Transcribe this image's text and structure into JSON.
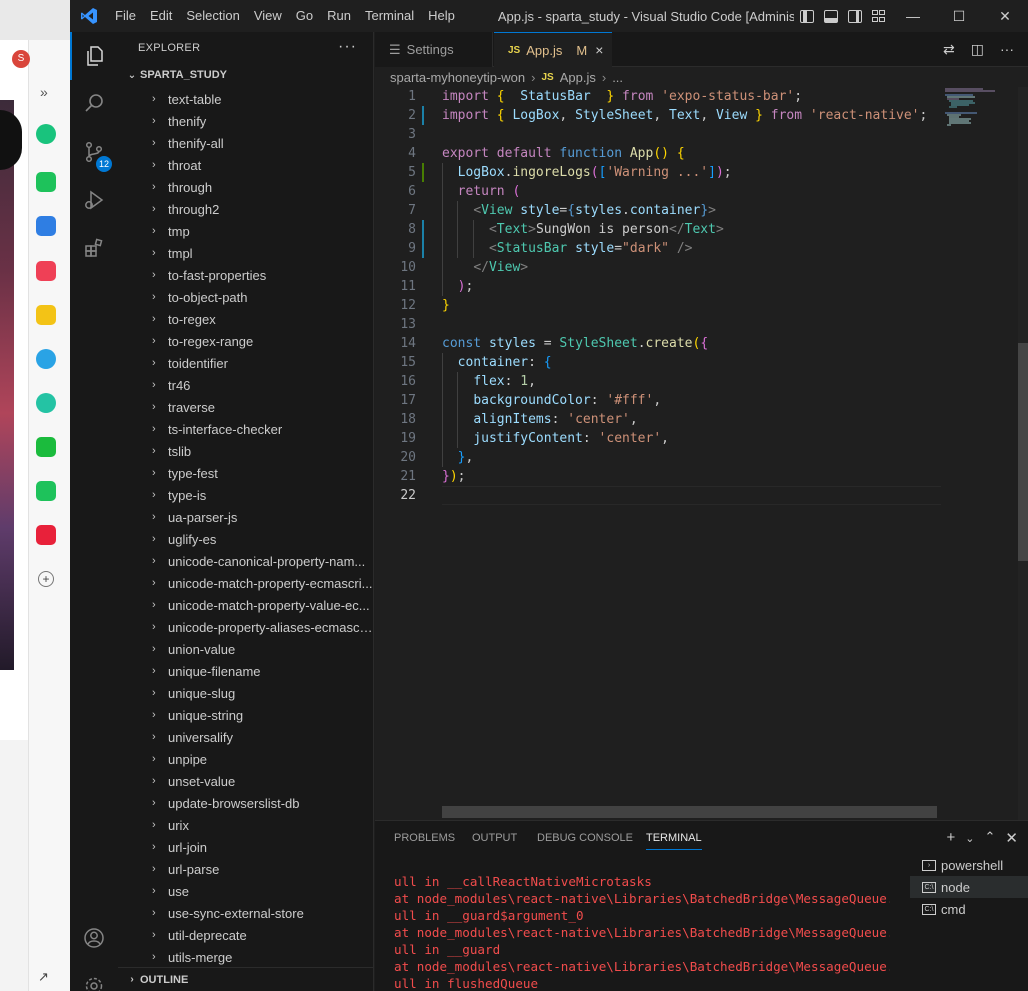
{
  "browser": {
    "avatar_letter": "S",
    "chevron": "»"
  },
  "titlebar": {
    "menu": [
      "File",
      "Edit",
      "Selection",
      "View",
      "Go",
      "Run",
      "Terminal",
      "Help"
    ],
    "title": "App.js - sparta_study - Visual Studio Code [Administra..."
  },
  "activity": {
    "scm_badge": "12"
  },
  "sidebar": {
    "header": "EXPLORER",
    "more": "···",
    "root": "SPARTA_STUDY",
    "outline": "OUTLINE",
    "items": [
      "text-table",
      "thenify",
      "thenify-all",
      "throat",
      "through",
      "through2",
      "tmp",
      "tmpl",
      "to-fast-properties",
      "to-object-path",
      "to-regex",
      "to-regex-range",
      "toidentifier",
      "tr46",
      "traverse",
      "ts-interface-checker",
      "tslib",
      "type-fest",
      "type-is",
      "ua-parser-js",
      "uglify-es",
      "unicode-canonical-property-nam...",
      "unicode-match-property-ecmascri...",
      "unicode-match-property-value-ec...",
      "unicode-property-aliases-ecmascr...",
      "union-value",
      "unique-filename",
      "unique-slug",
      "unique-string",
      "universalify",
      "unpipe",
      "unset-value",
      "update-browserslist-db",
      "urix",
      "url-join",
      "url-parse",
      "use",
      "use-sync-external-store",
      "util-deprecate",
      "utils-merge"
    ]
  },
  "tabs": {
    "settings": "Settings",
    "active_badge": "JS",
    "active": "App.js",
    "modified": "M",
    "close": "×"
  },
  "breadcrumb": {
    "folder": "sparta-myhoneytip-won",
    "badge": "JS",
    "file": "App.js",
    "rest": "..."
  },
  "editor": {
    "lines": [
      {
        "n": "1",
        "gutter": "",
        "tokens": [
          [
            "k",
            "import "
          ],
          [
            "b1",
            "{"
          ],
          [
            "",
            "  "
          ],
          [
            "v",
            "StatusBar"
          ],
          [
            "",
            "  "
          ],
          [
            "b1",
            "}"
          ],
          [
            "k",
            " from "
          ],
          [
            "s",
            "'expo-status-bar'"
          ],
          [
            "",
            ";"
          ]
        ]
      },
      {
        "n": "2",
        "gutter": "modified",
        "tokens": [
          [
            "k",
            "import "
          ],
          [
            "b1",
            "{"
          ],
          [
            "",
            " "
          ],
          [
            "v",
            "LogBox"
          ],
          [
            "",
            ", "
          ],
          [
            "v",
            "StyleSheet"
          ],
          [
            "",
            ", "
          ],
          [
            "v",
            "Text"
          ],
          [
            "",
            ", "
          ],
          [
            "v",
            "View"
          ],
          [
            "",
            " "
          ],
          [
            "b1",
            "}"
          ],
          [
            "k",
            " from "
          ],
          [
            "s",
            "'react-native'"
          ],
          [
            "",
            ";"
          ]
        ]
      },
      {
        "n": "3",
        "gutter": "",
        "tokens": []
      },
      {
        "n": "4",
        "gutter": "",
        "tokens": [
          [
            "k",
            "export default "
          ],
          [
            "kb",
            "function "
          ],
          [
            "f",
            "App"
          ],
          [
            "b1",
            "()"
          ],
          [
            "",
            " "
          ],
          [
            "b1",
            "{"
          ]
        ]
      },
      {
        "n": "5",
        "gutter": "added",
        "tokens": [
          [
            "",
            "  "
          ],
          [
            "v",
            "LogBox"
          ],
          [
            "",
            "."
          ],
          [
            "f",
            "ingoreLogs"
          ],
          [
            "b2",
            "("
          ],
          [
            "b3",
            "["
          ],
          [
            "s",
            "'Warning ...'"
          ],
          [
            "b3",
            "]"
          ],
          [
            "b2",
            ")"
          ],
          [
            "",
            ";"
          ]
        ]
      },
      {
        "n": "6",
        "gutter": "",
        "tokens": [
          [
            "",
            "  "
          ],
          [
            "k",
            "return "
          ],
          [
            "b2",
            "("
          ]
        ]
      },
      {
        "n": "7",
        "gutter": "",
        "tokens": [
          [
            "",
            "    "
          ],
          [
            "t",
            "<"
          ],
          [
            "c",
            "View"
          ],
          [
            "",
            " "
          ],
          [
            "v",
            "style"
          ],
          [
            "",
            "="
          ],
          [
            "kb",
            "{"
          ],
          [
            "v",
            "styles"
          ],
          [
            "",
            "."
          ],
          [
            "v",
            "container"
          ],
          [
            "kb",
            "}"
          ],
          [
            "t",
            ">"
          ]
        ]
      },
      {
        "n": "8",
        "gutter": "modified",
        "tokens": [
          [
            "",
            "      "
          ],
          [
            "t",
            "<"
          ],
          [
            "c",
            "Text"
          ],
          [
            "t",
            ">"
          ],
          [
            "",
            "SungWon is person"
          ],
          [
            "t",
            "</"
          ],
          [
            "c",
            "Text"
          ],
          [
            "t",
            ">"
          ]
        ]
      },
      {
        "n": "9",
        "gutter": "modified",
        "tokens": [
          [
            "",
            "      "
          ],
          [
            "t",
            "<"
          ],
          [
            "c",
            "StatusBar"
          ],
          [
            "",
            " "
          ],
          [
            "v",
            "style"
          ],
          [
            "",
            "="
          ],
          [
            "s",
            "\"dark\""
          ],
          [
            "",
            " "
          ],
          [
            "t",
            "/>"
          ]
        ]
      },
      {
        "n": "10",
        "gutter": "",
        "tokens": [
          [
            "",
            "    "
          ],
          [
            "t",
            "</"
          ],
          [
            "c",
            "View"
          ],
          [
            "t",
            ">"
          ]
        ]
      },
      {
        "n": "11",
        "gutter": "",
        "tokens": [
          [
            "",
            "  "
          ],
          [
            "b2",
            ")"
          ],
          [
            "",
            ";"
          ]
        ]
      },
      {
        "n": "12",
        "gutter": "",
        "tokens": [
          [
            "b1",
            "}"
          ]
        ]
      },
      {
        "n": "13",
        "gutter": "",
        "tokens": []
      },
      {
        "n": "14",
        "gutter": "",
        "tokens": [
          [
            "kb",
            "const "
          ],
          [
            "v",
            "styles"
          ],
          [
            "",
            " = "
          ],
          [
            "c",
            "StyleSheet"
          ],
          [
            "",
            "."
          ],
          [
            "f",
            "create"
          ],
          [
            "b1",
            "("
          ],
          [
            "b2",
            "{"
          ]
        ]
      },
      {
        "n": "15",
        "gutter": "",
        "tokens": [
          [
            "",
            "  "
          ],
          [
            "v",
            "container"
          ],
          [
            "",
            ": "
          ],
          [
            "b3",
            "{"
          ]
        ]
      },
      {
        "n": "16",
        "gutter": "",
        "tokens": [
          [
            "",
            "    "
          ],
          [
            "v",
            "flex"
          ],
          [
            "",
            ": "
          ],
          [
            "n",
            "1"
          ],
          [
            "",
            ","
          ]
        ]
      },
      {
        "n": "17",
        "gutter": "",
        "tokens": [
          [
            "",
            "    "
          ],
          [
            "v",
            "backgroundColor"
          ],
          [
            "",
            ": "
          ],
          [
            "s",
            "'#fff'"
          ],
          [
            "",
            ","
          ]
        ]
      },
      {
        "n": "18",
        "gutter": "",
        "tokens": [
          [
            "",
            "    "
          ],
          [
            "v",
            "alignItems"
          ],
          [
            "",
            ": "
          ],
          [
            "s",
            "'center'"
          ],
          [
            "",
            ","
          ]
        ]
      },
      {
        "n": "19",
        "gutter": "",
        "tokens": [
          [
            "",
            "    "
          ],
          [
            "v",
            "justifyContent"
          ],
          [
            "",
            ": "
          ],
          [
            "s",
            "'center'"
          ],
          [
            "",
            ","
          ]
        ]
      },
      {
        "n": "20",
        "gutter": "",
        "tokens": [
          [
            "",
            "  "
          ],
          [
            "b3",
            "}"
          ],
          [
            "",
            ","
          ]
        ]
      },
      {
        "n": "21",
        "gutter": "",
        "tokens": [
          [
            "b2",
            "}"
          ],
          [
            "b1",
            ")"
          ],
          [
            "",
            ";"
          ]
        ]
      },
      {
        "n": "22",
        "gutter": "",
        "tokens": []
      }
    ]
  },
  "panel": {
    "tabs": [
      "PROBLEMS",
      "OUTPUT",
      "DEBUG CONSOLE",
      "TERMINAL"
    ],
    "active_tab": "TERMINAL",
    "terminal_lines": [
      "ull in __callReactNativeMicrotasks",
      "at node_modules\\react-native\\Libraries\\BatchedBridge\\MessageQueue.js:n",
      "ull in __guard$argument_0",
      "at node_modules\\react-native\\Libraries\\BatchedBridge\\MessageQueue.js:n",
      "ull in __guard",
      "at node_modules\\react-native\\Libraries\\BatchedBridge\\MessageQueue.js:n",
      "ull in flushedQueue"
    ],
    "terminals": [
      "powershell",
      "node",
      "cmd"
    ],
    "active_terminal": "node"
  },
  "colors": {
    "accent": "#0078d4",
    "editor_bg": "#1f1f1f",
    "sidebar_bg": "#181818",
    "error_text": "#f14c4c",
    "modified_gutter": "#1b81a8",
    "added_gutter": "#487e02"
  }
}
